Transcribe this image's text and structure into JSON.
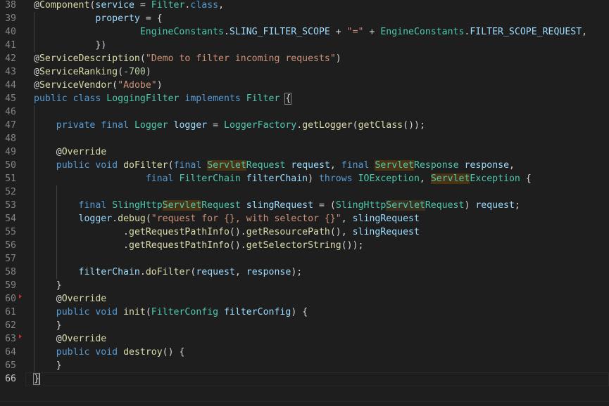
{
  "editor": {
    "active_line": "66",
    "lines": [
      {
        "num": "38",
        "tokens": [
          {
            "t": "@",
            "c": "at"
          },
          {
            "t": "Component",
            "c": "a"
          },
          {
            "t": "(",
            "c": "p"
          },
          {
            "t": "service",
            "c": "v"
          },
          {
            "t": " = ",
            "c": "p"
          },
          {
            "t": "Filter",
            "c": "t"
          },
          {
            "t": ".",
            "c": "p"
          },
          {
            "t": "class",
            "c": "k"
          },
          {
            "t": ",",
            "c": "p"
          }
        ]
      },
      {
        "num": "39",
        "tokens": [
          {
            "t": "           ",
            "c": "p"
          },
          {
            "t": "property",
            "c": "v"
          },
          {
            "t": " = {",
            "c": "p"
          }
        ]
      },
      {
        "num": "40",
        "tokens": [
          {
            "t": "                   ",
            "c": "p"
          },
          {
            "t": "EngineConstants",
            "c": "t"
          },
          {
            "t": ".",
            "c": "p"
          },
          {
            "t": "SLING_FILTER_SCOPE",
            "c": "v"
          },
          {
            "t": " + ",
            "c": "p"
          },
          {
            "t": "\"=\"",
            "c": "s"
          },
          {
            "t": " + ",
            "c": "p"
          },
          {
            "t": "EngineConstants",
            "c": "t"
          },
          {
            "t": ".",
            "c": "p"
          },
          {
            "t": "FILTER_SCOPE_REQUEST",
            "c": "v"
          },
          {
            "t": ",",
            "c": "p"
          }
        ]
      },
      {
        "num": "41",
        "tokens": [
          {
            "t": "           })",
            "c": "p"
          }
        ]
      },
      {
        "num": "42",
        "tokens": [
          {
            "t": "@",
            "c": "at"
          },
          {
            "t": "ServiceDescription",
            "c": "a"
          },
          {
            "t": "(",
            "c": "p"
          },
          {
            "t": "\"Demo to filter incoming requests\"",
            "c": "s"
          },
          {
            "t": ")",
            "c": "p"
          }
        ]
      },
      {
        "num": "43",
        "tokens": [
          {
            "t": "@",
            "c": "at"
          },
          {
            "t": "ServiceRanking",
            "c": "a"
          },
          {
            "t": "(",
            "c": "p"
          },
          {
            "t": "-700",
            "c": "n"
          },
          {
            "t": ")",
            "c": "p"
          }
        ]
      },
      {
        "num": "44",
        "tokens": [
          {
            "t": "@",
            "c": "at"
          },
          {
            "t": "ServiceVendor",
            "c": "a"
          },
          {
            "t": "(",
            "c": "p"
          },
          {
            "t": "\"Adobe\"",
            "c": "s"
          },
          {
            "t": ")",
            "c": "p"
          }
        ]
      },
      {
        "num": "45",
        "tokens": [
          {
            "t": "public",
            "c": "k"
          },
          {
            "t": " ",
            "c": "p"
          },
          {
            "t": "class",
            "c": "k"
          },
          {
            "t": " ",
            "c": "p"
          },
          {
            "t": "LoggingFilter",
            "c": "t"
          },
          {
            "t": " ",
            "c": "p"
          },
          {
            "t": "implements",
            "c": "k"
          },
          {
            "t": " ",
            "c": "p"
          },
          {
            "t": "Filter",
            "c": "t"
          },
          {
            "t": " ",
            "c": "p"
          },
          {
            "t": "{",
            "c": "p bracket-box"
          }
        ]
      },
      {
        "num": "46",
        "tokens": []
      },
      {
        "num": "47",
        "tokens": [
          {
            "t": "    ",
            "c": "p"
          },
          {
            "t": "private",
            "c": "k"
          },
          {
            "t": " ",
            "c": "p"
          },
          {
            "t": "final",
            "c": "k"
          },
          {
            "t": " ",
            "c": "p"
          },
          {
            "t": "Logger",
            "c": "t"
          },
          {
            "t": " ",
            "c": "p"
          },
          {
            "t": "logger",
            "c": "v"
          },
          {
            "t": " = ",
            "c": "p"
          },
          {
            "t": "LoggerFactory",
            "c": "t"
          },
          {
            "t": ".",
            "c": "p"
          },
          {
            "t": "getLogger",
            "c": "f"
          },
          {
            "t": "(",
            "c": "p"
          },
          {
            "t": "getClass",
            "c": "f"
          },
          {
            "t": "());",
            "c": "p"
          }
        ]
      },
      {
        "num": "48",
        "tokens": []
      },
      {
        "num": "49",
        "tokens": [
          {
            "t": "    ",
            "c": "p"
          },
          {
            "t": "@",
            "c": "at"
          },
          {
            "t": "Override",
            "c": "a"
          }
        ]
      },
      {
        "num": "50",
        "tokens": [
          {
            "t": "    ",
            "c": "p"
          },
          {
            "t": "public",
            "c": "k"
          },
          {
            "t": " ",
            "c": "p"
          },
          {
            "t": "void",
            "c": "k"
          },
          {
            "t": " ",
            "c": "p"
          },
          {
            "t": "doFilter",
            "c": "f"
          },
          {
            "t": "(",
            "c": "p"
          },
          {
            "t": "final",
            "c": "k"
          },
          {
            "t": " ",
            "c": "p"
          },
          {
            "t": "Servlet",
            "c": "t hl"
          },
          {
            "t": "Request",
            "c": "t"
          },
          {
            "t": " ",
            "c": "p"
          },
          {
            "t": "request",
            "c": "v"
          },
          {
            "t": ", ",
            "c": "p"
          },
          {
            "t": "final",
            "c": "k"
          },
          {
            "t": " ",
            "c": "p"
          },
          {
            "t": "Servlet",
            "c": "t hl"
          },
          {
            "t": "Response",
            "c": "t"
          },
          {
            "t": " ",
            "c": "p"
          },
          {
            "t": "response",
            "c": "v"
          },
          {
            "t": ",",
            "c": "p"
          }
        ]
      },
      {
        "num": "51",
        "tokens": [
          {
            "t": "                    ",
            "c": "p"
          },
          {
            "t": "final",
            "c": "k"
          },
          {
            "t": " ",
            "c": "p"
          },
          {
            "t": "FilterChain",
            "c": "t"
          },
          {
            "t": " ",
            "c": "p"
          },
          {
            "t": "filterChain",
            "c": "v"
          },
          {
            "t": ") ",
            "c": "p"
          },
          {
            "t": "throws",
            "c": "k"
          },
          {
            "t": " ",
            "c": "p"
          },
          {
            "t": "IOException",
            "c": "t"
          },
          {
            "t": ", ",
            "c": "p"
          },
          {
            "t": "Servlet",
            "c": "t hl"
          },
          {
            "t": "Exception",
            "c": "t"
          },
          {
            "t": " {",
            "c": "p"
          }
        ]
      },
      {
        "num": "52",
        "tokens": []
      },
      {
        "num": "53",
        "tokens": [
          {
            "t": "        ",
            "c": "p"
          },
          {
            "t": "final",
            "c": "k"
          },
          {
            "t": " ",
            "c": "p"
          },
          {
            "t": "SlingHttp",
            "c": "t"
          },
          {
            "t": "Servlet",
            "c": "t hl"
          },
          {
            "t": "Request",
            "c": "t"
          },
          {
            "t": " ",
            "c": "p"
          },
          {
            "t": "slingRequest",
            "c": "v"
          },
          {
            "t": " = (",
            "c": "p"
          },
          {
            "t": "SlingHttp",
            "c": "t"
          },
          {
            "t": "Servlet",
            "c": "t hl2"
          },
          {
            "t": "Request",
            "c": "t"
          },
          {
            "t": ") ",
            "c": "p"
          },
          {
            "t": "request",
            "c": "v"
          },
          {
            "t": ";",
            "c": "p"
          }
        ]
      },
      {
        "num": "54",
        "tokens": [
          {
            "t": "        ",
            "c": "p"
          },
          {
            "t": "logger",
            "c": "v"
          },
          {
            "t": ".",
            "c": "p"
          },
          {
            "t": "debug",
            "c": "f"
          },
          {
            "t": "(",
            "c": "p"
          },
          {
            "t": "\"request for {}, with selector {}\"",
            "c": "s"
          },
          {
            "t": ", ",
            "c": "p"
          },
          {
            "t": "slingRequest",
            "c": "v"
          }
        ]
      },
      {
        "num": "55",
        "tokens": [
          {
            "t": "                ",
            "c": "p"
          },
          {
            "t": ".",
            "c": "p"
          },
          {
            "t": "getRequestPathInfo",
            "c": "f"
          },
          {
            "t": "().",
            "c": "p"
          },
          {
            "t": "getResourcePath",
            "c": "f"
          },
          {
            "t": "(), ",
            "c": "p"
          },
          {
            "t": "slingRequest",
            "c": "v"
          }
        ]
      },
      {
        "num": "56",
        "tokens": [
          {
            "t": "                ",
            "c": "p"
          },
          {
            "t": ".",
            "c": "p"
          },
          {
            "t": "getRequestPathInfo",
            "c": "f"
          },
          {
            "t": "().",
            "c": "p"
          },
          {
            "t": "getSelectorString",
            "c": "f"
          },
          {
            "t": "());",
            "c": "p"
          }
        ]
      },
      {
        "num": "57",
        "tokens": []
      },
      {
        "num": "58",
        "tokens": [
          {
            "t": "        ",
            "c": "p"
          },
          {
            "t": "filterChain",
            "c": "v"
          },
          {
            "t": ".",
            "c": "p"
          },
          {
            "t": "doFilter",
            "c": "f"
          },
          {
            "t": "(",
            "c": "p"
          },
          {
            "t": "request",
            "c": "v"
          },
          {
            "t": ", ",
            "c": "p"
          },
          {
            "t": "response",
            "c": "v"
          },
          {
            "t": ");",
            "c": "p"
          }
        ]
      },
      {
        "num": "59",
        "tokens": [
          {
            "t": "    }",
            "c": "p"
          }
        ]
      },
      {
        "num": "60",
        "tokens": [
          {
            "t": "    ",
            "c": "p"
          },
          {
            "t": "@",
            "c": "at"
          },
          {
            "t": "Override",
            "c": "a"
          }
        ]
      },
      {
        "num": "61",
        "tokens": [
          {
            "t": "    ",
            "c": "p"
          },
          {
            "t": "public",
            "c": "k"
          },
          {
            "t": " ",
            "c": "p"
          },
          {
            "t": "void",
            "c": "k"
          },
          {
            "t": " ",
            "c": "p"
          },
          {
            "t": "init",
            "c": "f"
          },
          {
            "t": "(",
            "c": "p"
          },
          {
            "t": "FilterConfig",
            "c": "t"
          },
          {
            "t": " ",
            "c": "p"
          },
          {
            "t": "filterConfig",
            "c": "v"
          },
          {
            "t": ") {",
            "c": "p"
          }
        ]
      },
      {
        "num": "62",
        "tokens": [
          {
            "t": "    }",
            "c": "p"
          }
        ]
      },
      {
        "num": "63",
        "tokens": [
          {
            "t": "    ",
            "c": "p"
          },
          {
            "t": "@",
            "c": "at"
          },
          {
            "t": "Override",
            "c": "a"
          }
        ]
      },
      {
        "num": "64",
        "tokens": [
          {
            "t": "    ",
            "c": "p"
          },
          {
            "t": "public",
            "c": "k"
          },
          {
            "t": " ",
            "c": "p"
          },
          {
            "t": "void",
            "c": "k"
          },
          {
            "t": " ",
            "c": "p"
          },
          {
            "t": "destroy",
            "c": "f"
          },
          {
            "t": "() {",
            "c": "p"
          }
        ]
      },
      {
        "num": "65",
        "tokens": [
          {
            "t": "    }",
            "c": "p"
          }
        ]
      },
      {
        "num": "66",
        "tokens": [
          {
            "t": "}",
            "c": "p bracket-box"
          }
        ]
      }
    ]
  }
}
